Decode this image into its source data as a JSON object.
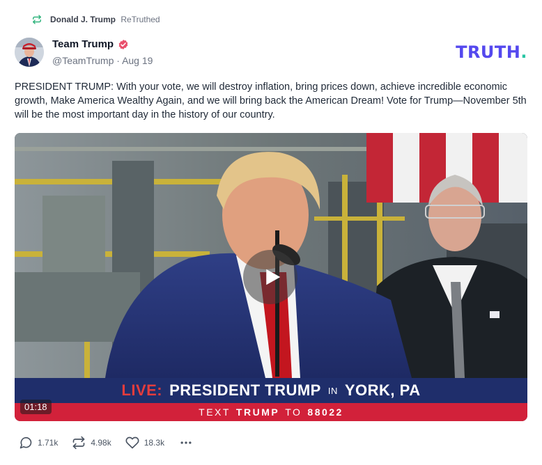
{
  "retruth": {
    "user": "Donald J. Trump",
    "label": "ReTruthed"
  },
  "author": {
    "name": "Team Trump",
    "handle": "@TeamTrump",
    "separator": "·",
    "date": "Aug 19"
  },
  "brand": {
    "logo_text": "TRUTH",
    "logo_dot": "."
  },
  "post": {
    "text": "PRESIDENT TRUMP: With your vote, we will destroy inflation, bring prices down, achieve incredible economic growth, Make America Wealthy Again, and we will bring back the American Dream! Vote for Trump—November 5th will be the most important day in the history of our country."
  },
  "video": {
    "duration": "01:18",
    "banner": {
      "live": "LIVE:",
      "headline": "PRESIDENT TRUMP",
      "in": "IN",
      "location": "YORK, PA"
    },
    "subbanner": {
      "prefix": "TEXT",
      "keyword": "TRUMP",
      "middle": "TO",
      "number": "88022"
    }
  },
  "actions": {
    "replies": "1.71k",
    "retruths": "4.98k",
    "likes": "18.3k"
  },
  "colors": {
    "accent": "#5448ee",
    "logo_dot": "#28c6a3",
    "verified": "#e94f6b",
    "retruth_icon": "#2fb37c",
    "banner": "#1f2e6b",
    "subbanner": "#d2213a"
  },
  "icons": [
    "retruth-icon",
    "verified-icon",
    "play-icon",
    "reply-icon",
    "repost-icon",
    "heart-icon",
    "more-icon"
  ]
}
